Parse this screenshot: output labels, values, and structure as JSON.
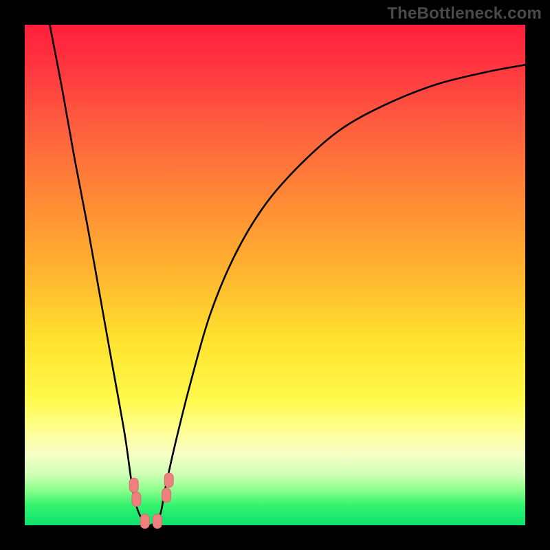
{
  "watermark": "TheBottleneck.com",
  "chart_data": {
    "type": "line",
    "title": "",
    "xlabel": "",
    "ylabel": "",
    "xlim": [
      0,
      100
    ],
    "ylim": [
      0,
      100
    ],
    "series": [
      {
        "name": "bottleneck-curve",
        "x": [
          5,
          7.5,
          10,
          12.5,
          15,
          17.5,
          20,
          21.6,
          23,
          25,
          27,
          28,
          30,
          33,
          37,
          42,
          48,
          55,
          63,
          72,
          82,
          92,
          100
        ],
        "y": [
          100,
          87,
          73,
          60,
          46,
          32,
          18,
          7,
          2,
          0,
          2,
          7,
          16,
          28,
          42,
          54,
          64,
          72,
          79,
          84,
          88,
          90.5,
          92
        ]
      }
    ],
    "markers": [
      {
        "name": "left-cluster-top",
        "x": 21.8,
        "y": 8.0
      },
      {
        "name": "left-cluster-bottom",
        "x": 22.3,
        "y": 5.2
      },
      {
        "name": "floor-left",
        "x": 24.0,
        "y": 0.8
      },
      {
        "name": "floor-right",
        "x": 26.5,
        "y": 0.8
      },
      {
        "name": "right-cluster-bottom",
        "x": 28.3,
        "y": 6.0
      },
      {
        "name": "right-cluster-top",
        "x": 28.8,
        "y": 9.0
      }
    ],
    "gradient_background": {
      "top_color": "#ff1f3c",
      "mid_color": "#ffe22e",
      "bottom_color": "#0de26c"
    }
  }
}
